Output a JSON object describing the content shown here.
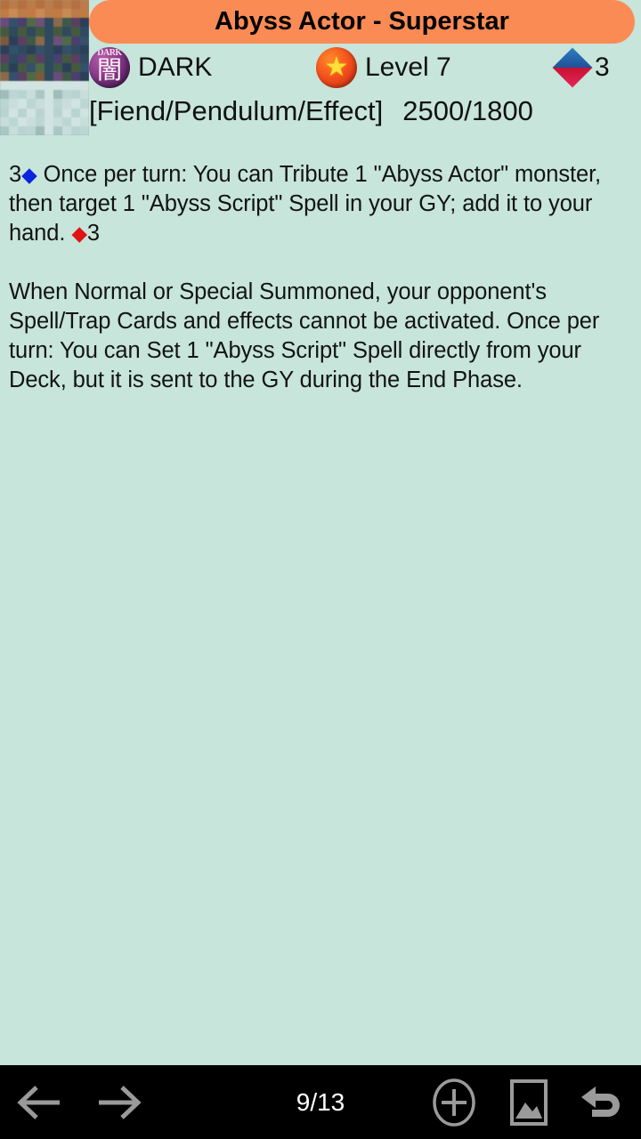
{
  "colors": {
    "background": "#c7e5da",
    "title_bar": "#fa8b55",
    "bottom_bar": "#000000",
    "icon_gray": "#9a9a9a",
    "pendulum_blue": "#0b24e0",
    "pendulum_red": "#e01414"
  },
  "header": {
    "card_thumbnail_name": "card-artwork-thumbnail",
    "title": "Abyss Actor - Superstar",
    "attribute": {
      "icon": "dark-attribute-icon",
      "icon_top_text": "DARK",
      "icon_kanji": "闇",
      "label": "DARK"
    },
    "level": {
      "icon": "level-star-icon",
      "label": "Level 7"
    },
    "pendulum_scale": {
      "icon": "pendulum-scale-icon",
      "value": "3"
    },
    "type_line": "[Fiend/Pendulum/Effect]",
    "atk_def": "2500/1800"
  },
  "card_text": {
    "pendulum_effect": {
      "scale_left": "3",
      "diamond_blue": "◆",
      "text": " Once per turn: You can Tribute 1 \"Abyss Actor\" monster, then target 1 \"Abyss Script\" Spell in your GY; add it to your hand. ",
      "diamond_red": "◆",
      "scale_right": "3"
    },
    "monster_effect": "When Normal or Special Summoned, your opponent's Spell/Trap Cards and effects cannot be activated. Once per turn: You can Set 1 \"Abyss Script\" Spell directly from your Deck, but it is sent to the GY during the End Phase."
  },
  "bottom_bar": {
    "prev_icon": "arrow-left-icon",
    "next_icon": "arrow-right-icon",
    "page_counter": "9/13",
    "add_icon": "plus-circle-icon",
    "image_icon": "picture-icon",
    "back_icon": "undo-arrow-icon"
  }
}
